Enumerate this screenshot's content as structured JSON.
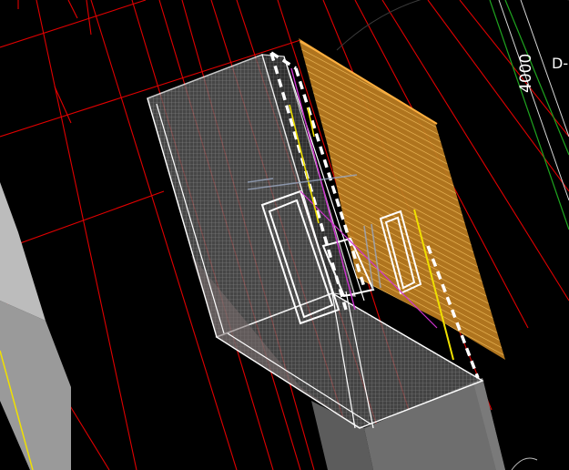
{
  "canvas": {
    "background": "#000000"
  },
  "annotations": {
    "dimension_value": "4000",
    "grid_tag": "D-"
  },
  "colors": {
    "grid_red": "#e00000",
    "grid_green": "#1fa51f",
    "wireframe_white": "#ffffff",
    "mesh_gray": "#8a8a8a",
    "surface_orange": "#f4a53a",
    "highlight_yellow": "#f0e000",
    "magenta": "#d033d0",
    "solid_gray": "#9a9a9a"
  }
}
